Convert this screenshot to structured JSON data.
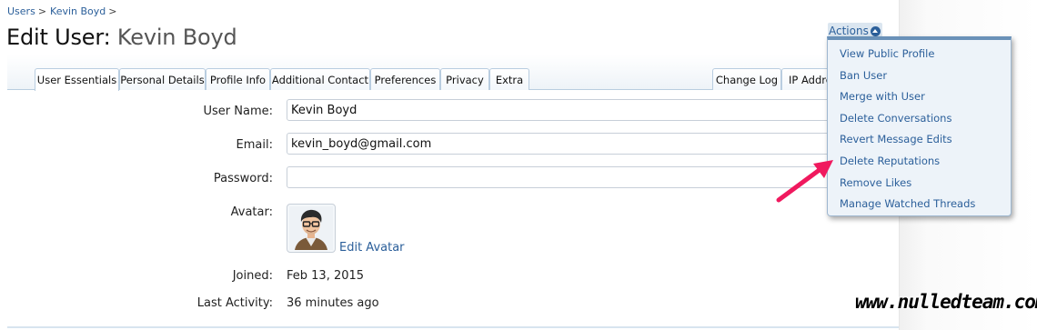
{
  "breadcrumb": {
    "items": [
      "Users",
      "Kevin Boyd"
    ],
    "separator": ">"
  },
  "page": {
    "title_prefix": "Edit User:",
    "title_subject": "Kevin Boyd"
  },
  "actions": {
    "label": "Actions",
    "icon": "chevron-up-icon",
    "menu": [
      "View Public Profile",
      "Ban User",
      "Merge with User",
      "Delete Conversations",
      "Revert Message Edits",
      "Delete Reputations",
      "Remove Likes",
      "Manage Watched Threads"
    ]
  },
  "tabs": {
    "left": [
      "User Essentials",
      "Personal Details",
      "Profile Info",
      "Additional Contact",
      "Preferences",
      "Privacy",
      "Extra"
    ],
    "right": [
      "Change Log",
      "IP Addre"
    ],
    "active": "User Essentials"
  },
  "form": {
    "username_label": "User Name:",
    "username_value": "Kevin Boyd",
    "email_label": "Email:",
    "email_value": "kevin_boyd@gmail.com",
    "password_label": "Password:",
    "password_value": "",
    "avatar_label": "Avatar:",
    "avatar_edit_link": "Edit Avatar",
    "joined_label": "Joined:",
    "joined_value": "Feb 13, 2015",
    "last_activity_label": "Last Activity:",
    "last_activity_value": "36 minutes ago"
  },
  "watermark": "www.nulledteam.com",
  "colors": {
    "link": "#2b5f9a",
    "menu_bg": "#edf3f9",
    "menu_border": "#6a91b8",
    "tab_border": "#b9cde0",
    "arrow": "#f0195e"
  }
}
